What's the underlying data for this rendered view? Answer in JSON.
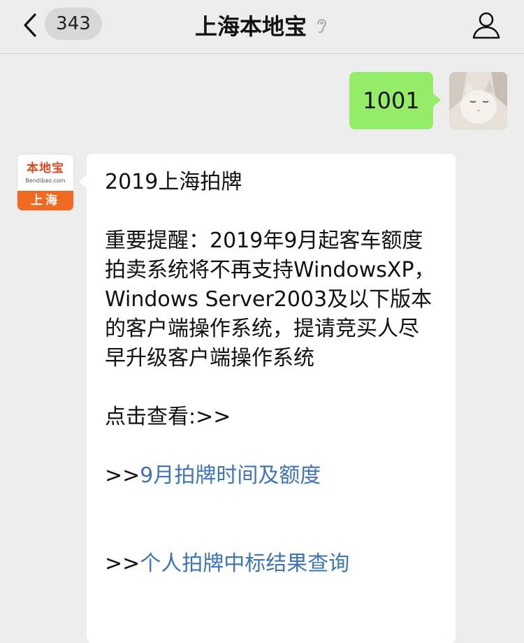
{
  "header": {
    "unread_count": "343",
    "title": "上海本地宝"
  },
  "messages": {
    "sent": {
      "text": "1001"
    },
    "received": {
      "logo": {
        "brand": "本地宝",
        "domain": "Bendibao.com",
        "city": "上海"
      },
      "headline": "2019上海拍牌",
      "notice": "重要提醒：2019年9月起客车额度拍卖系统将不再支持WindowsXP，Windows Server2003及以下版本的客户端操作系统，提请竞买人尽早升级客户端操作系统",
      "click_prompt": "点击查看:>>",
      "links": [
        {
          "prefix": ">>",
          "text": "9月拍牌时间及额度"
        },
        {
          "prefix": ">>",
          "text": "个人拍牌中标结果查询"
        }
      ]
    }
  },
  "colors": {
    "sent_bubble": "#95ec69",
    "link": "#3f75b6",
    "background": "#ededed",
    "logo_accent": "#f26a21"
  },
  "icons": [
    "back-arrow-icon",
    "ear-icon",
    "user-icon"
  ]
}
